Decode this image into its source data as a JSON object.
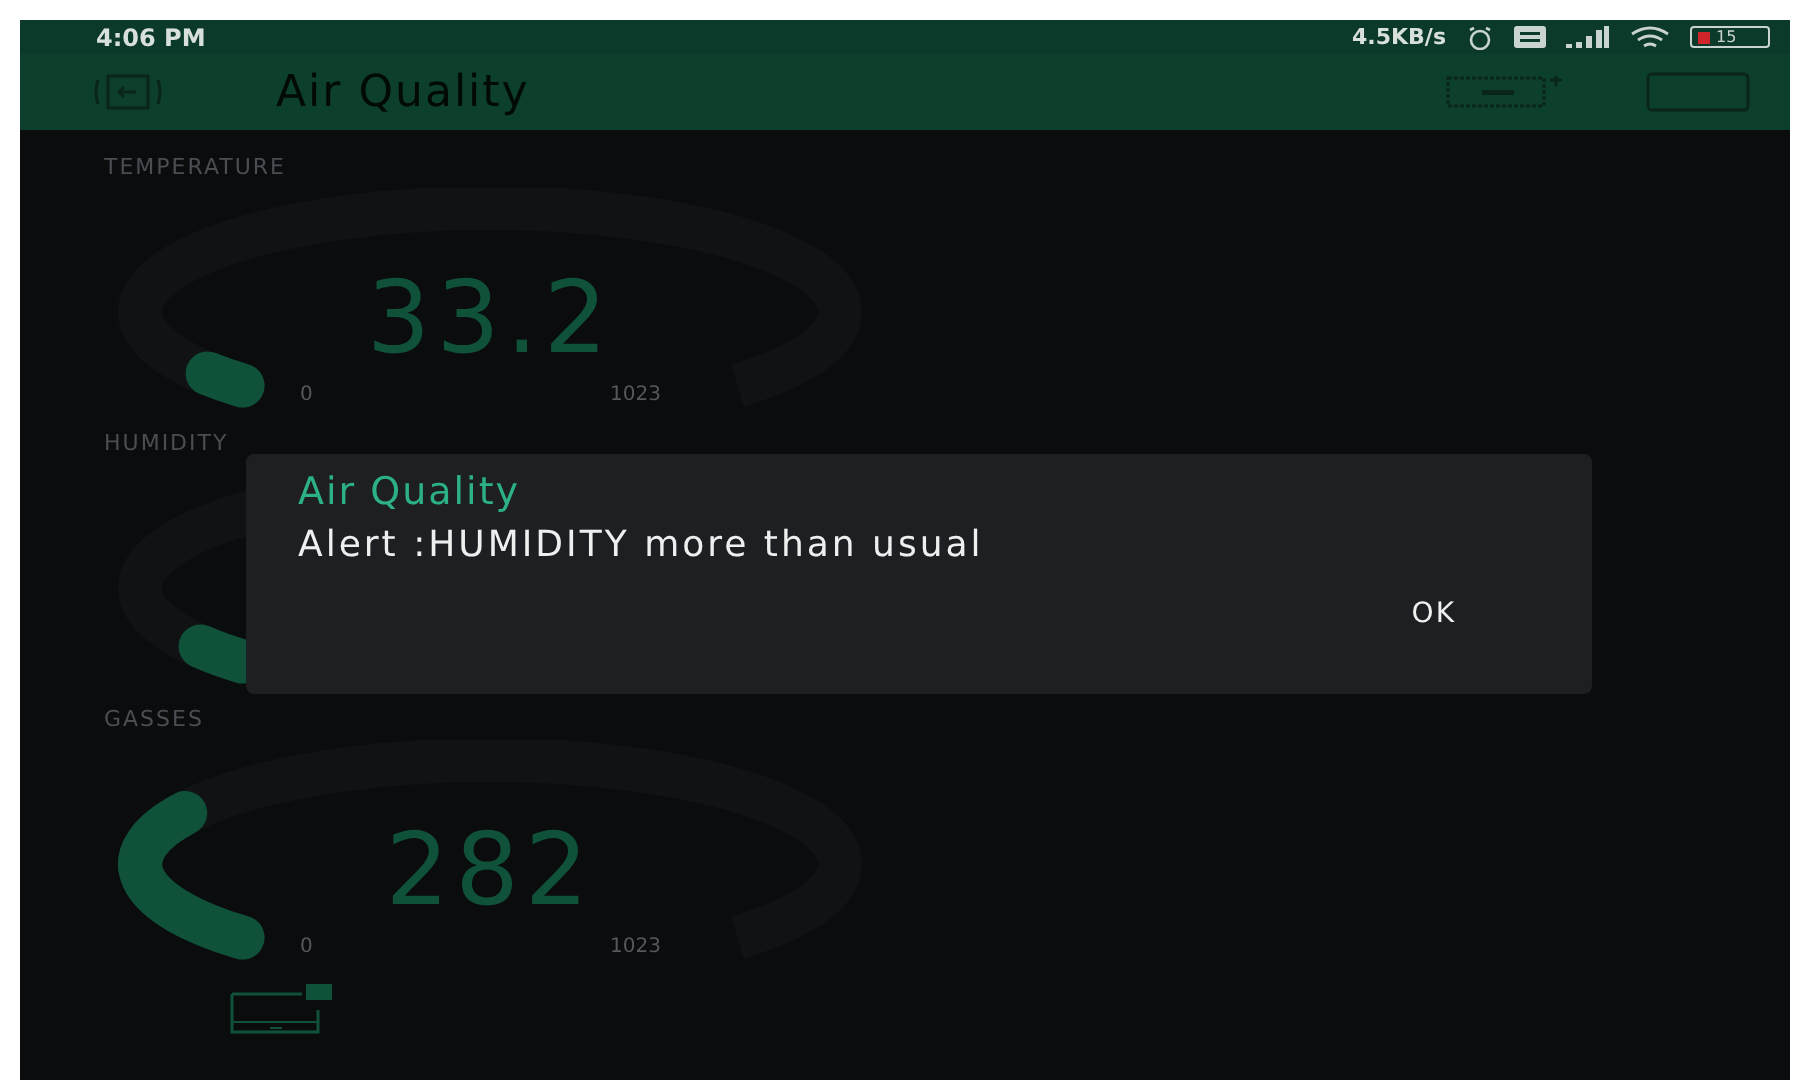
{
  "status_bar": {
    "time": "4:06 PM",
    "network_speed": "4.5KB/s",
    "battery": "15"
  },
  "app_bar": {
    "title": "Air Quality"
  },
  "gauges": [
    {
      "label": "TEMPERATURE",
      "value": "33.2",
      "min": "0",
      "max": "1023"
    },
    {
      "label": "HUMIDITY"
    },
    {
      "label": "GASSES",
      "value": "282",
      "min": "0",
      "max": "1023"
    }
  ],
  "dialog": {
    "title": "Air Quality",
    "message": "Alert :HUMIDITY more than usual",
    "button": "OK"
  }
}
